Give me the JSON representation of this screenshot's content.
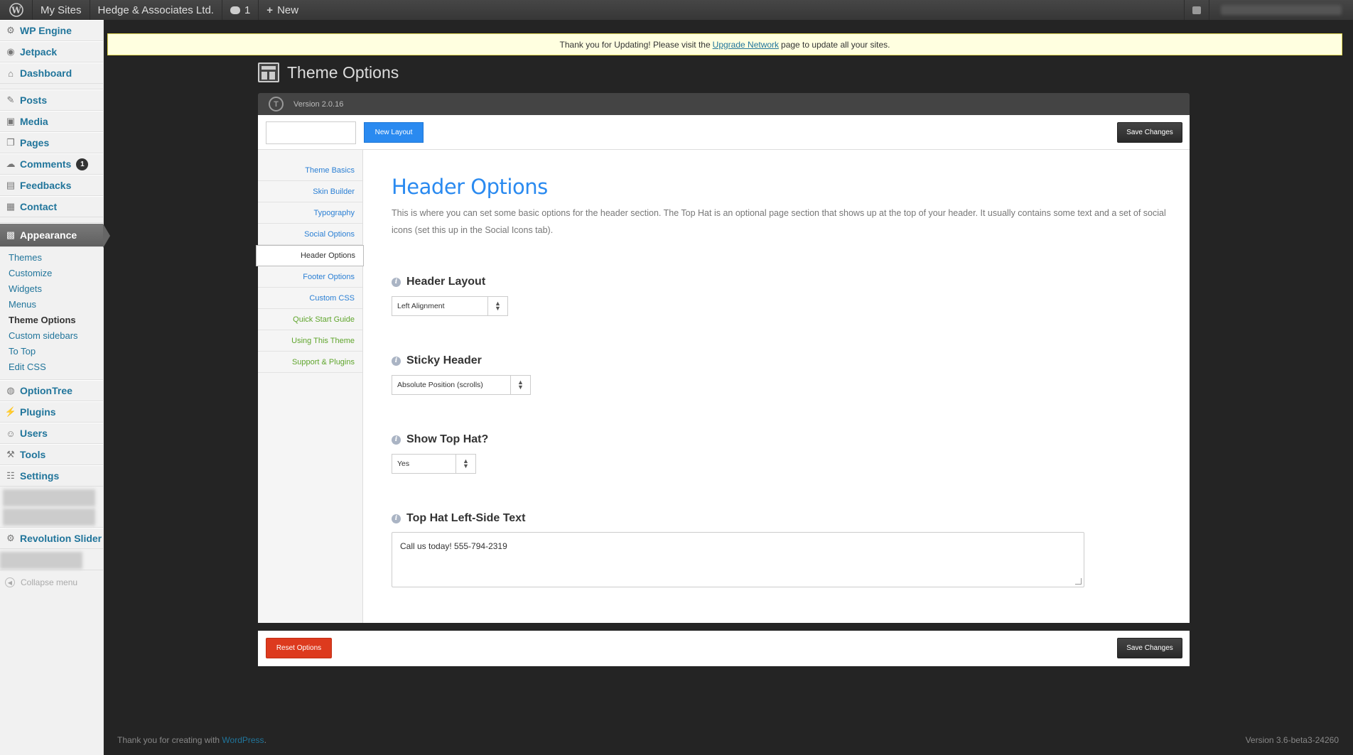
{
  "adminbar": {
    "my_sites": "My Sites",
    "site_name": "Hedge & Associates Ltd.",
    "comments_count": "1",
    "new_label": "New"
  },
  "sidebar": {
    "top_items": [
      {
        "label": "WP Engine",
        "icon": "gear-icon"
      },
      {
        "label": "Jetpack",
        "icon": "jetpack-icon"
      },
      {
        "label": "Dashboard",
        "icon": "dashboard-icon"
      }
    ],
    "content_items": [
      {
        "label": "Posts",
        "icon": "pin-icon"
      },
      {
        "label": "Media",
        "icon": "media-icon"
      },
      {
        "label": "Pages",
        "icon": "pages-icon"
      },
      {
        "label": "Comments",
        "icon": "comment-icon",
        "badge": "1"
      },
      {
        "label": "Feedbacks",
        "icon": "feedback-icon"
      },
      {
        "label": "Contact",
        "icon": "contact-icon"
      }
    ],
    "appearance": "Appearance",
    "appearance_sub": [
      "Themes",
      "Customize",
      "Widgets",
      "Menus",
      "Theme Options",
      "Custom sidebars",
      "To Top",
      "Edit CSS"
    ],
    "appearance_active": "Theme Options",
    "lower_items": [
      {
        "label": "OptionTree",
        "icon": "optiontree-icon"
      },
      {
        "label": "Plugins",
        "icon": "plugin-icon"
      },
      {
        "label": "Users",
        "icon": "users-icon"
      },
      {
        "label": "Tools",
        "icon": "tools-icon"
      },
      {
        "label": "Settings",
        "icon": "settings-icon"
      }
    ],
    "revolution": "Revolution Slider",
    "collapse": "Collapse menu"
  },
  "notice": {
    "before": "Thank you for Updating! Please visit the",
    "link": "Upgrade Network",
    "after": "page to update all your sites."
  },
  "page": {
    "title": "Theme Options",
    "version": "Version 2.0.16"
  },
  "toolbar": {
    "new_layout": "New Layout",
    "save": "Save Changes",
    "layout_input_value": ""
  },
  "tabs": [
    {
      "label": "Theme Basics",
      "style": "blue"
    },
    {
      "label": "Skin Builder",
      "style": "blue"
    },
    {
      "label": "Typography",
      "style": "blue"
    },
    {
      "label": "Social Options",
      "style": "blue"
    },
    {
      "label": "Header Options",
      "style": "active"
    },
    {
      "label": "Footer Options",
      "style": "blue"
    },
    {
      "label": "Custom CSS",
      "style": "blue"
    },
    {
      "label": "Quick Start Guide",
      "style": "green"
    },
    {
      "label": "Using This Theme",
      "style": "green"
    },
    {
      "label": "Support & Plugins",
      "style": "green"
    }
  ],
  "content": {
    "heading": "Header Options",
    "description": "This is where you can set some basic options for the header section. The Top Hat is an optional page section that shows up at the top of your header. It usually contains some text and a set of social icons (set this up in the Social Icons tab).",
    "fields": {
      "header_layout": {
        "label": "Header Layout",
        "value": "Left Alignment"
      },
      "sticky_header": {
        "label": "Sticky Header",
        "value": "Absolute Position (scrolls)"
      },
      "show_top_hat": {
        "label": "Show Top Hat?",
        "value": "Yes"
      },
      "top_hat_text": {
        "label": "Top Hat Left-Side Text",
        "value": "Call us today! 555-794-2319"
      }
    }
  },
  "footer_bar": {
    "reset": "Reset Options",
    "save": "Save Changes"
  },
  "wp_footer": {
    "left_text": "Thank you for creating with",
    "left_link": "WordPress",
    "left_end": ".",
    "version": "Version 3.6-beta3-24260"
  },
  "colors": {
    "accent_blue": "#2a8af0",
    "reset_red": "#dd3a1e",
    "link_blue": "#21759b",
    "green_tab": "#5fa52c"
  }
}
